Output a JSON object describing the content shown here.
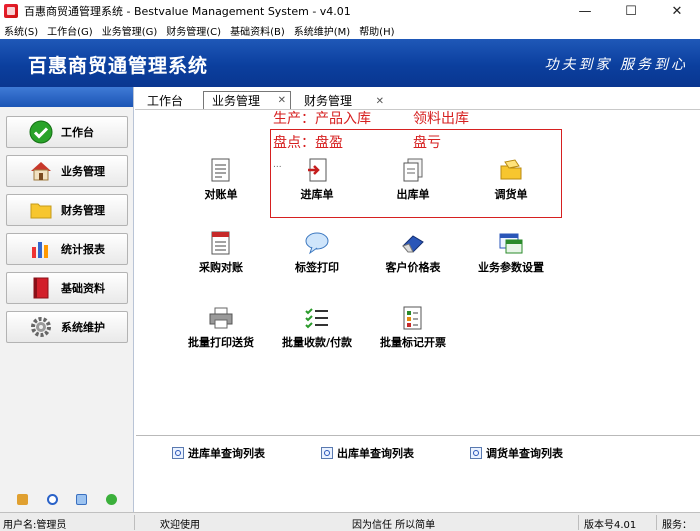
{
  "window": {
    "title": "百惠商贸通管理系统 - Bestvalue Management System - v4.01",
    "minimize": "—",
    "maximize": "☐",
    "close": "✕"
  },
  "menu": [
    "系统(S)",
    "工作台(G)",
    "业务管理(G)",
    "财务管理(C)",
    "基础资料(B)",
    "系统维护(M)",
    "帮助(H)"
  ],
  "banner": {
    "title": "百惠商贸通管理系统",
    "slogan": "功夫到家 服务到心"
  },
  "sidebar": {
    "items": [
      {
        "label": "工作台",
        "icon": "check-icon"
      },
      {
        "label": "业务管理",
        "icon": "house-icon"
      },
      {
        "label": "财务管理",
        "icon": "folder-icon"
      },
      {
        "label": "统计报表",
        "icon": "bar-chart-icon"
      },
      {
        "label": "基础资料",
        "icon": "book-icon"
      },
      {
        "label": "系统维护",
        "icon": "gear-icon"
      }
    ]
  },
  "tabs": [
    {
      "label": "工作台"
    },
    {
      "label": "业务管理",
      "closable": true
    },
    {
      "label": "财务管理",
      "closable": true
    }
  ],
  "annotations": {
    "line1a": "生产：产品入库",
    "line1b": "领料出库",
    "line2a": "盘点：盘盈",
    "line2b": "盘亏",
    "dots": "..."
  },
  "functions": [
    {
      "label": "对账单",
      "icon": "document-icon"
    },
    {
      "label": "进库单",
      "icon": "stock-in-icon"
    },
    {
      "label": "出库单",
      "icon": "stock-out-icon"
    },
    {
      "label": "调货单",
      "icon": "folder-transfer-icon"
    },
    {
      "label": "采购对账",
      "icon": "purchase-doc-icon"
    },
    {
      "label": "标签打印",
      "icon": "speech-bubble-icon"
    },
    {
      "label": "客户价格表",
      "icon": "eraser-icon"
    },
    {
      "label": "业务参数设置",
      "icon": "window-settings-icon"
    },
    {
      "label": "批量打印送货",
      "icon": "printer-icon"
    },
    {
      "label": "批量收款/付款",
      "icon": "checklist-icon"
    },
    {
      "label": "批量标记开票",
      "icon": "invoice-icon"
    }
  ],
  "queries": [
    {
      "label": "进库单查询列表"
    },
    {
      "label": "出库单查询列表"
    },
    {
      "label": "调货单查询列表"
    }
  ],
  "status": {
    "user": "用户名:管理员",
    "welcome": "欢迎使用",
    "motto": "因为信任 所以简单",
    "version": "版本号4.01",
    "service": "服务："
  },
  "colors": {
    "banner": "#0b3f9e",
    "annotation": "#d62020"
  }
}
